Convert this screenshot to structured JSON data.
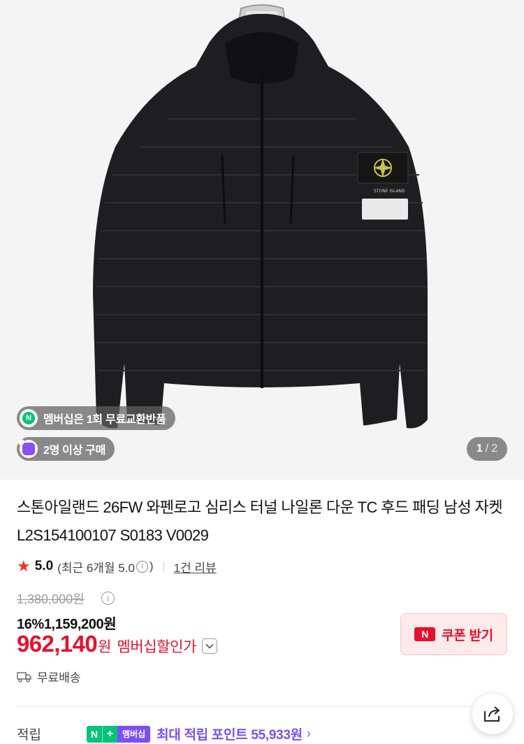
{
  "hero": {
    "membership_badge": "멤버십은 1회 무료교환반품",
    "membership_icon_letter": "N",
    "group_badge": "2명 이상 구매",
    "counter_current": "1",
    "counter_sep": "/",
    "counter_total": "2"
  },
  "product": {
    "title": "스톤아일랜드 26FW 와펜로고 심리스 터널 나일론 다운 TC 후드 패딩 남성 자켓 L2S154100107 S0183 V0029"
  },
  "rating": {
    "score": "5.0",
    "recent_label": "(최근 6개월 5.0",
    "recent_close": ")",
    "reviews": "1건 리뷰"
  },
  "price": {
    "original": "1,380,000원",
    "discount_line": "16%1,159,200원",
    "final_amount": "962,140",
    "final_unit": "원",
    "final_label": "멤버십할인가"
  },
  "coupon": {
    "logo": "N",
    "label": "쿠폰 받기"
  },
  "shipping": {
    "label": "무료배송"
  },
  "points": {
    "label": "적립",
    "badge_n": "N",
    "badge_plus": "+",
    "badge_text": "멤버십",
    "text": "최대 적립 포인트 55,933원",
    "arrow": "›"
  },
  "colors": {
    "accent_red": "#e6112d",
    "membership_purple": "#7a4ff5",
    "naver_green": "#08c37a",
    "rating_star": "#f0321e"
  }
}
